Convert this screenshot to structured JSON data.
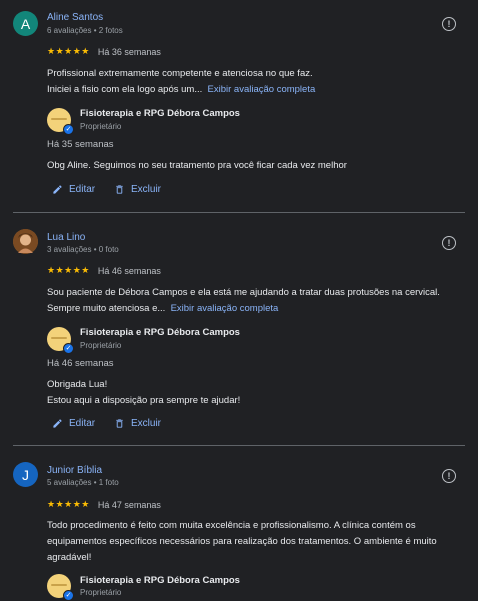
{
  "colors": {
    "background": "#202124",
    "link": "#8ab4f8",
    "star": "#fbbc04",
    "divider": "#5f6368"
  },
  "reviews": [
    {
      "avatar_letter": "A",
      "avatar_color": "#12867a",
      "author": "Aline Santos",
      "meta": "6 avaliações • 2 fotos",
      "stars": "★★★★★",
      "rating": 5,
      "time": "Há 36 semanas",
      "text_line1": "Profissional extremamente competente e atenciosa no que faz.",
      "text_line2": "Iniciei a fisio com ela logo após um...",
      "more": "Exibir avaliação completa",
      "owner_name": "Fisioterapia e RPG Débora Campos",
      "owner_role": "Proprietário",
      "reply_time": "Há 35 semanas",
      "reply_line1": "Obg Aline. Seguimos no seu tratamento pra você ficar cada vez melhor",
      "reply_line2": "",
      "edit": "Editar",
      "delete": "Excluir"
    },
    {
      "avatar_letter": "",
      "avatar_color": "#8a5a2b",
      "author": "Lua Lino",
      "meta": "3 avaliações • 0 foto",
      "stars": "★★★★★",
      "rating": 5,
      "time": "Há 46 semanas",
      "text_line1": "Sou paciente de Débora Campos e ela está me ajudando a tratar duas protusões na cervical.",
      "text_line2": "Sempre muito atenciosa e...",
      "more": "Exibir avaliação completa",
      "owner_name": "Fisioterapia e RPG Débora Campos",
      "owner_role": "Proprietário",
      "reply_time": "Há 46 semanas",
      "reply_line1": "Obrigada Lua!",
      "reply_line2": "Estou aqui a disposição pra sempre te ajudar!",
      "edit": "Editar",
      "delete": "Excluir"
    },
    {
      "avatar_letter": "J",
      "avatar_color": "#1565c0",
      "author": "Junior Bíblia",
      "meta": "5 avaliações • 1 foto",
      "stars": "★★★★★",
      "rating": 5,
      "time": "Há 47 semanas",
      "text_line1": "Todo procedimento é feito com muita excelência e profissionalismo. A clínica contém os",
      "text_line2": "equipamentos específicos necessários para realização dos tratamentos. O ambiente é muito",
      "text_line3": "agradável!",
      "owner_name": "Fisioterapia e RPG Débora Campos",
      "owner_role": "Proprietário"
    }
  ]
}
